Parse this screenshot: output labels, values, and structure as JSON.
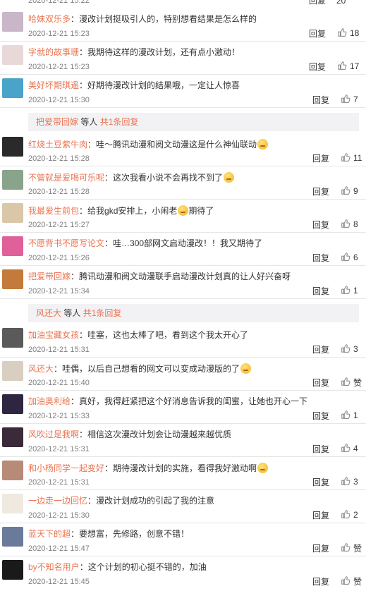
{
  "top": {
    "date": "2020-12-21 15:22",
    "reply": "回复",
    "likes": "20"
  },
  "comments": [
    {
      "user": "哈妹双乐多",
      "text": "漫改计划挺吸引人的，特别想看结果是怎么样的",
      "date": "2020-12-21 15:23",
      "reply": "回复",
      "likes": "18",
      "avatar": "#c9b6c8"
    },
    {
      "user": "字就的故事珊",
      "text": "我期待这样的漫改计划，还有点小激动！",
      "date": "2020-12-21 15:23",
      "reply": "回复",
      "likes": "17",
      "avatar": "#e8d9d8"
    },
    {
      "user": "美好坏期琪遥",
      "text": "好期待漫改计划的结果哦，一定让人惊喜",
      "date": "2020-12-21 15:30",
      "reply": "回复",
      "likes": "7",
      "avatar": "#4aa3c9"
    },
    {
      "user": "红烧土豆紫牛肉",
      "text": "哇～腾讯动漫和阅文动漫这是什么神仙联动",
      "date": "2020-12-21 15:28",
      "reply": "回复",
      "likes": "11",
      "avatar": "#2a2a2a"
    },
    {
      "user": "不管就是爱喝可乐呢",
      "text": "这次我看小说不会再找不到了",
      "date": "2020-12-21 15:28",
      "reply": "回复",
      "likes": "9",
      "avatar": "#8aa38b"
    },
    {
      "user": "我最爱生前包",
      "text": "给我gkd安排上，小闹老",
      "text2": "期待了",
      "date": "2020-12-21 15:27",
      "reply": "回复",
      "likes": "8",
      "avatar": "#d9c7a8"
    },
    {
      "user": "不愿背书不愿写论文",
      "text": "哇…300部网文启动漫改！！我又期待了",
      "date": "2020-12-21 15:26",
      "reply": "回复",
      "likes": "6",
      "avatar": "#e0609a"
    },
    {
      "user": "把爱带回嫁",
      "text": "腾讯动漫和阅文动漫联手启动漫改计划真的让人好兴奋呀",
      "date": "2020-12-21 15:34",
      "reply": "回复",
      "likes": "1",
      "avatar": "#c47a3a"
    },
    {
      "user": "加油宝藏女孩",
      "text": "哇塞，这也太棒了吧，看到这个我太开心了",
      "date": "2020-12-21 15:31",
      "reply": "回复",
      "likes": "3",
      "avatar": "#5a5a5a"
    },
    {
      "user": "风还大",
      "text": "哇偶，以后自己想看的网文可以变成动漫版的了",
      "date": "2020-12-21 15:40",
      "reply": "回复",
      "likes": "赞",
      "avatar": "#d8cfc0"
    },
    {
      "user": "加油奥利给",
      "text": "真好，我得赶紧把这个好消息告诉我的闺蜜，让她也开心一下",
      "date": "2020-12-21 15:33",
      "reply": "回复",
      "likes": "1",
      "avatar": "#2e2540"
    },
    {
      "user": "风吹过是我啊",
      "text": "相信这次漫改计划会让动漫越来越优质",
      "date": "2020-12-21 15:31",
      "reply": "回复",
      "likes": "4",
      "avatar": "#3b2a3a"
    },
    {
      "user": "和小杨同学一起变好",
      "text": "期待漫改计划的实施，看得我好激动啊",
      "date": "2020-12-21 15:31",
      "reply": "回复",
      "likes": "3",
      "avatar": "#b88a78"
    },
    {
      "user": "一边走一边回忆",
      "text": "漫改计划成功的引起了我的注意",
      "date": "2020-12-21 15:30",
      "reply": "回复",
      "likes": "2",
      "avatar": "#efe9e0"
    },
    {
      "user": "蓝天下的超",
      "text": "要想富，先修路，创意不错！",
      "date": "2020-12-21 15:47",
      "reply": "回复",
      "likes": "赞",
      "avatar": "#6a7a9a"
    },
    {
      "user": "by不知名用户",
      "text": "这个计划的初心挺不错的，加油",
      "date": "2020-12-21 15:45",
      "reply": "回复",
      "likes": "赞",
      "avatar": "#1a1a1a"
    }
  ],
  "subreplies": [
    {
      "name": "把爱带回嫁",
      "mid": " 等人 ",
      "count": "共1条回复"
    },
    {
      "name": "风还大",
      "mid": " 等人 ",
      "count": "共1条回复"
    }
  ]
}
